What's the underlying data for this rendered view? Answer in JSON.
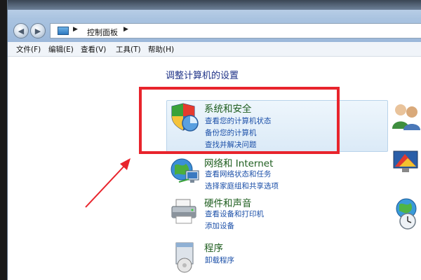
{
  "address_bar": {
    "path_label": "控制面板"
  },
  "menu": {
    "items": [
      "文件(F)",
      "编辑(E)",
      "查看(V)",
      "工具(T)",
      "帮助(H)"
    ]
  },
  "main": {
    "heading": "调整计算机的设置",
    "categories": [
      {
        "title": "系统和安全",
        "links": [
          "查看您的计算机状态",
          "备份您的计算机",
          "查找并解决问题"
        ]
      },
      {
        "title": "网络和 Internet",
        "links": [
          "查看网络状态和任务",
          "选择家庭组和共享选项"
        ]
      },
      {
        "title": "硬件和声音",
        "links": [
          "查看设备和打印机",
          "添加设备"
        ]
      },
      {
        "title": "程序",
        "links": [
          "卸载程序"
        ]
      }
    ]
  },
  "colors": {
    "annotation_red": "#e8242c",
    "category_title": "#1e5d1e",
    "link_blue": "#1b4fa8"
  },
  "icons": [
    "back-arrow-icon",
    "forward-arrow-icon",
    "control-panel-icon",
    "shield-icon",
    "network-icon",
    "printer-icon",
    "programs-icon",
    "users-icon",
    "display-icon",
    "globe-clock-icon"
  ]
}
